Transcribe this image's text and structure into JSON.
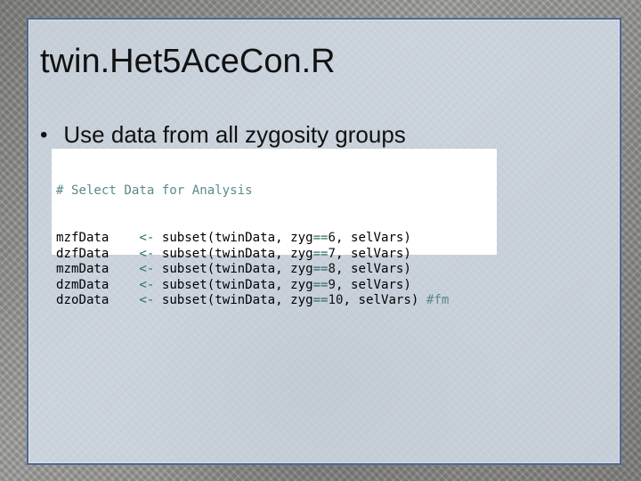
{
  "slide": {
    "title": "twin.Het5AceCon.R",
    "bullet": "Use data from all zygosity groups"
  },
  "code": {
    "comment": "# Select Data for Analysis",
    "lines": [
      {
        "var": "mzfData",
        "assign": "<-",
        "call": "subset(twinData,",
        "arg": "zyg",
        "eq": "==",
        "num": "6",
        "rest": ", selVars)",
        "trail": ""
      },
      {
        "var": "dzfData",
        "assign": "<-",
        "call": "subset(twinData,",
        "arg": "zyg",
        "eq": "==",
        "num": "7",
        "rest": ", selVars)",
        "trail": ""
      },
      {
        "var": "mzmData",
        "assign": "<-",
        "call": "subset(twinData,",
        "arg": "zyg",
        "eq": "==",
        "num": "8",
        "rest": ", selVars)",
        "trail": ""
      },
      {
        "var": "dzmData",
        "assign": "<-",
        "call": "subset(twinData,",
        "arg": "zyg",
        "eq": "==",
        "num": "9",
        "rest": ", selVars)",
        "trail": ""
      },
      {
        "var": "dzoData",
        "assign": "<-",
        "call": "subset(twinData,",
        "arg": "zyg",
        "eq": "==",
        "num": "10",
        "rest": ", selVars)",
        "trail": " #fm"
      }
    ]
  },
  "colors": {
    "panel_border": "#4b6a95",
    "comment": "#5a8a8a",
    "operator": "#2e6b6b"
  }
}
